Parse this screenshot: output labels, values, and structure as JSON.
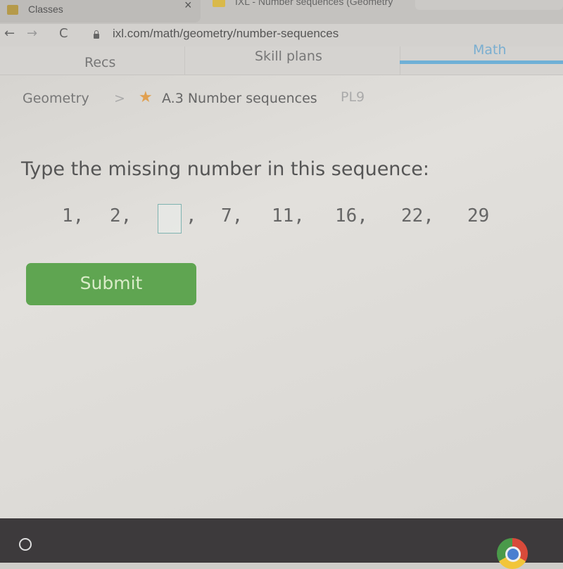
{
  "browser": {
    "tabs": [
      {
        "title": "Classes",
        "close_icon": "×"
      },
      {
        "title": "IXL - Number sequences (Geometry"
      }
    ],
    "nav": {
      "back": "←",
      "forward": "→",
      "reload": "C"
    },
    "url": "ixl.com/math/geometry/number-sequences"
  },
  "subnav": {
    "items": [
      {
        "label": "Recs"
      },
      {
        "label": "Skill plans"
      },
      {
        "label": "Math",
        "active": true
      }
    ],
    "accent": "#6fb0d6"
  },
  "breadcrumb": {
    "subject": "Geometry",
    "separator": ">",
    "star_icon": "★",
    "skill": "A.3 Number sequences",
    "code": "PL9"
  },
  "question": {
    "prompt": "Type the missing number in this sequence:",
    "sequence": [
      "1,",
      "2,",
      "",
      "7,",
      "11,",
      "16,",
      "22,",
      "29"
    ],
    "answer_value": "",
    "answer_comma": ","
  },
  "submit": {
    "label": "Submit",
    "color": "#5fa551"
  },
  "shelf": {
    "launcher_icon": "launcher-icon",
    "app_icon": "chrome-icon"
  }
}
